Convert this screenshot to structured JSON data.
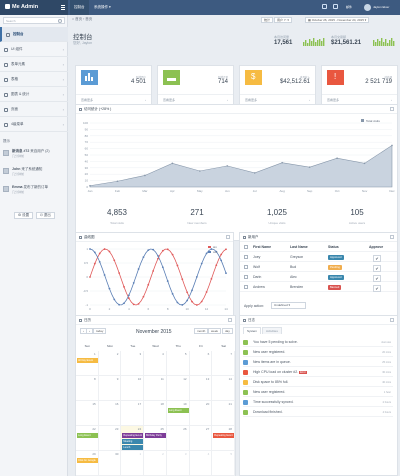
{
  "app": {
    "title": "Me Admin"
  },
  "topnav": {
    "items": [
      "控制台",
      "系统操作"
    ],
    "user": "Jaylon Elver",
    "notif": "9",
    "email": "邮件"
  },
  "sidebar": {
    "search_placeholder": "Search",
    "items": [
      "控制台",
      "UI 组件",
      "表单元素",
      "表格",
      "图表 & 统计",
      "页面",
      "4级菜单"
    ],
    "msg_title": "提示",
    "messages": [
      {
        "name": "新消息 #72",
        "text": "来自用户 (2)",
        "time": "几分钟前"
      },
      {
        "name": "John",
        "text": "来了系统通知",
        "time": "几分钟前"
      },
      {
        "name": "Emma",
        "text": "发布了新的订单",
        "time": "几分钟前"
      }
    ],
    "btn_settings": "设置",
    "btn_logout": "退出"
  },
  "toolbar": {
    "crumb_home": "首页",
    "crumb_current": "首页",
    "stats": "统计",
    "date_range": "October 26, 2015 - November 24, 2015",
    "user_filter": "用户 Y:"
  },
  "page": {
    "title": "控制台",
    "subtitle": "您好, Jaylon"
  },
  "header_stats": [
    {
      "label": "本月访问量",
      "value": "17,561"
    },
    {
      "label": "本月交易额",
      "value": "$21,561.21"
    }
  ],
  "cards": [
    {
      "label": "新增用户",
      "value": "4 501",
      "color": "#5b9bd5",
      "footer": "查看更多"
    },
    {
      "label": "新增订单",
      "value": "714",
      "color": "#8cc152",
      "footer": "查看更多"
    },
    {
      "label": "本月收入",
      "value": "$42,512.61",
      "color": "#f6bb42",
      "footer": "查看更多"
    },
    {
      "label": "待处理",
      "value": "2 521 719",
      "color": "#e9573f",
      "footer": "查看更多"
    }
  ],
  "visits": {
    "title": "访问统计 (+28% )",
    "legend": "Total visits",
    "stats": [
      {
        "value": "4,853",
        "label": "Total visits"
      },
      {
        "value": "271",
        "label": "New members"
      },
      {
        "value": "1,025",
        "label": "Unique visits"
      },
      {
        "value": "105",
        "label": "Active users"
      }
    ]
  },
  "wave": {
    "title": "曲线图",
    "legend": [
      "sin",
      "cos"
    ]
  },
  "users": {
    "title": "新用户",
    "columns": [
      "First Name",
      "Last Name",
      "Status",
      "Approve"
    ],
    "rows": [
      {
        "first": "Joey",
        "last": "Greyson",
        "status": "Approved",
        "color": "#3a87ad"
      },
      {
        "first": "Wolf",
        "last": "Bud",
        "status": "Pending",
        "color": "#f0ad4e"
      },
      {
        "first": "Darin",
        "last": "Alec",
        "status": "Approved",
        "color": "#3a87ad"
      },
      {
        "first": "Andrew",
        "last": "Brenden",
        "status": "Banned",
        "color": "#d9534f"
      }
    ],
    "apply_label": "Apply action:",
    "apply_value": "Undefined"
  },
  "calendar": {
    "title": "日历",
    "month": "November 2015",
    "views": [
      "month",
      "week",
      "day"
    ],
    "today": "today",
    "weekdays": [
      "Sun",
      "Mon",
      "Tue",
      "Wed",
      "Thu",
      "Fri",
      "Sat"
    ],
    "weeks": [
      [
        1,
        2,
        3,
        4,
        5,
        6,
        7
      ],
      [
        8,
        9,
        10,
        11,
        12,
        13,
        14
      ],
      [
        15,
        16,
        17,
        18,
        19,
        20,
        21
      ],
      [
        22,
        23,
        24,
        25,
        26,
        27,
        28
      ],
      [
        29,
        30,
        1,
        2,
        3,
        4,
        5
      ]
    ],
    "events": [
      {
        "label": "All Day Event",
        "week": 0,
        "day": 0,
        "color": "#f6bb42"
      },
      {
        "label": "Long Event",
        "week": 2,
        "day": 4,
        "color": "#8cc152"
      },
      {
        "label": "Long Event",
        "week": 3,
        "day": 0,
        "color": "#8cc152"
      },
      {
        "label": "Repeating Event",
        "week": 3,
        "day": 2,
        "color": "#7d3c98"
      },
      {
        "label": "Birthday Party",
        "week": 3,
        "day": 3,
        "color": "#7d3c98"
      },
      {
        "label": "Meeting",
        "week": 3,
        "day": 2,
        "color": "#3a87ad"
      },
      {
        "label": "Lunch",
        "week": 3,
        "day": 2,
        "color": "#3a87ad"
      },
      {
        "label": "Repeating Event",
        "week": 3,
        "day": 6,
        "color": "#e9573f"
      },
      {
        "label": "Click for Google",
        "week": 4,
        "day": 0,
        "color": "#f6bb42"
      }
    ]
  },
  "activity": {
    "title": "日志",
    "tabs": [
      "System",
      "Activities"
    ],
    "items": [
      {
        "text": "You have 5 pending to solve.",
        "date": "Just now",
        "color": "#8cc152"
      },
      {
        "text": "New user registered.",
        "date": "20 mins",
        "color": "#8cc152"
      },
      {
        "text": "New items are in queue.",
        "date": "25 mins",
        "color": "#5b9bd5"
      },
      {
        "text": "High CPU load on cluster #2.",
        "date": "30 mins",
        "color": "#e9573f",
        "badge": "Error"
      },
      {
        "text": "Disk space to 85% full.",
        "date": "40 mins",
        "color": "#f6bb42"
      },
      {
        "text": "New user registered.",
        "date": "1 hour",
        "color": "#8cc152"
      },
      {
        "text": "Time successfully synced.",
        "date": "2 hours",
        "color": "#5b9bd5"
      },
      {
        "text": "Download finished.",
        "date": "4 hours",
        "color": "#8cc152"
      }
    ]
  },
  "chart_data": [
    {
      "type": "area",
      "title": "访问统计 (+28% )",
      "categories": [
        "Jan",
        "Feb",
        "Mar",
        "Apr",
        "May",
        "Jun",
        "Jul",
        "Aug",
        "Sep",
        "Oct",
        "Nov",
        "Dec"
      ],
      "series": [
        {
          "name": "Total visits",
          "values": [
            2,
            9,
            18,
            37,
            25,
            33,
            22,
            38,
            31,
            45,
            37,
            65
          ]
        }
      ],
      "ylim": [
        0,
        100
      ],
      "yticks": [
        0,
        10,
        20,
        30,
        40,
        50,
        60,
        70,
        80,
        90,
        100
      ],
      "grid": true,
      "legend": "top-right"
    },
    {
      "type": "line",
      "title": "曲线图",
      "x": [
        0,
        2,
        4,
        6,
        8,
        10,
        12,
        14
      ],
      "xlim": [
        0,
        14
      ],
      "ylim": [
        -1,
        1
      ],
      "yticks": [
        -1,
        -0.5,
        0,
        0.5,
        1
      ],
      "series": [
        {
          "name": "sin",
          "color": "#e05a5a"
        },
        {
          "name": "cos",
          "color": "#5b7fb5"
        }
      ],
      "legend": "top-right"
    }
  ]
}
